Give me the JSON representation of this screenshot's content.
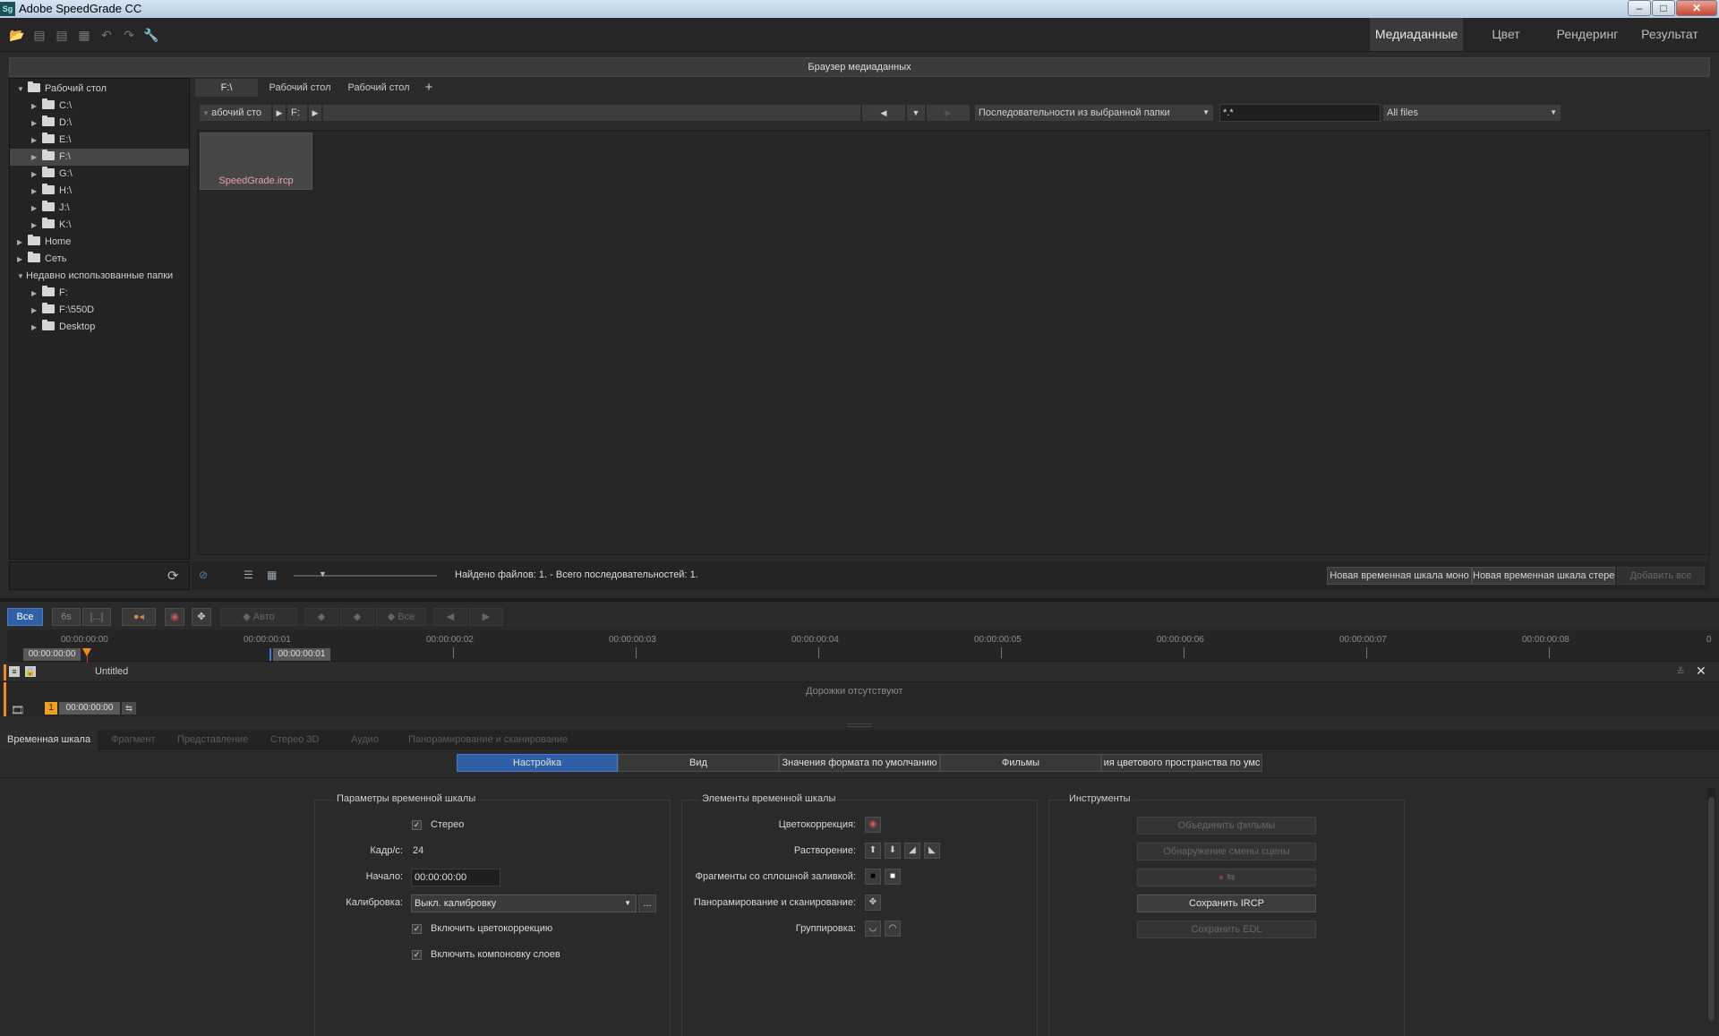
{
  "window": {
    "title": "Adobe SpeedGrade CC",
    "app_badge": "Sg",
    "minimize": "–",
    "maximize": "□",
    "close": "✕"
  },
  "toolbar": {
    "icons": [
      "open-folder-icon",
      "import-icon",
      "export-icon",
      "save-icon",
      "undo-icon",
      "redo-icon",
      "wrench-icon"
    ],
    "workspace_tabs": [
      "Медиаданные",
      "Цвет",
      "Рендеринг",
      "Результат"
    ],
    "active_workspace": "Медиаданные"
  },
  "media_browser": {
    "header": "Браузер медиаданных",
    "tree": [
      {
        "label": "Рабочий стол",
        "level": 0,
        "expanded": true
      },
      {
        "label": "C:\\",
        "level": 1,
        "expanded": false
      },
      {
        "label": "D:\\",
        "level": 1,
        "expanded": false
      },
      {
        "label": "E:\\",
        "level": 1,
        "expanded": false
      },
      {
        "label": "F:\\",
        "level": 1,
        "expanded": false,
        "selected": true
      },
      {
        "label": "G:\\",
        "level": 1,
        "expanded": false
      },
      {
        "label": "H:\\",
        "level": 1,
        "expanded": false
      },
      {
        "label": "J:\\",
        "level": 1,
        "expanded": false
      },
      {
        "label": "K:\\",
        "level": 1,
        "expanded": false
      },
      {
        "label": "Home",
        "level": 0,
        "expanded": false
      },
      {
        "label": "Сеть",
        "level": 0,
        "expanded": false
      },
      {
        "label": "Недавно использованные папки",
        "level": 0,
        "expanded": true,
        "no_folder": true
      },
      {
        "label": "F:",
        "level": 1,
        "expanded": false
      },
      {
        "label": "F:\\550D",
        "level": 1,
        "expanded": false
      },
      {
        "label": "Desktop",
        "level": 1,
        "expanded": false
      }
    ],
    "tabs": [
      "F:\\",
      "Рабочий стол",
      "Рабочий стол"
    ],
    "add_tab": "+",
    "path": {
      "segment1": "абочий сто",
      "segment2": "F:",
      "arrow": "▶",
      "prev": "◀",
      "down": "▼",
      "next": "▶"
    },
    "sequence_mode": "Последовательности из выбранной папки",
    "filter": "*.*",
    "file_type": "All files",
    "files": [
      {
        "name": "SpeedGrade.ircp"
      }
    ],
    "status": "Найдено файлов: 1. - Всего последовательностей: 1.",
    "buttons": {
      "new_mono": "Новая временная шкала моно",
      "new_stereo": "Новая временная шкала стерео",
      "add_all": "Добавить все"
    }
  },
  "timeline_toolbar": {
    "all": "Все",
    "six_s": "6s",
    "bracket": "|...|",
    "auto": "◆ Авто",
    "all2": "◆ Все"
  },
  "timeline": {
    "ruler_labels": [
      "00:00:00:00",
      "00:00:00:01",
      "00:00:00:02",
      "00:00:00:03",
      "00:00:00:04",
      "00:00:00:05",
      "00:00:00:06",
      "00:00:00:07",
      "00:00:00:08",
      "0"
    ],
    "in_marker": "00:00:00:00",
    "out_marker": "00:00:00:01",
    "track_name": "Untitled",
    "no_tracks": "Дорожки отсутствуют",
    "clip_number": "1",
    "clip_time": "00:00:00:00"
  },
  "bottom_tabs": [
    "Временная шкала",
    "Фрагмент",
    "Представление",
    "Стерео 3D",
    "Аудио",
    "Панорамирование и сканирование"
  ],
  "settings_tabs": [
    "Настройка",
    "Вид",
    "Значения формата по умолчанию",
    "Фильмы",
    "ия цветового пространства по умс"
  ],
  "params": {
    "title": "Параметры временной шкалы",
    "stereo": "Стерео",
    "fps_label": "Кадр/с:",
    "fps_value": "24",
    "start_label": "Начало:",
    "start_value": "00:00:00:00",
    "calibration_label": "Калибровка:",
    "calibration_value": "Выкл. калибровку",
    "ellipsis": "...",
    "enable_cc": "Включить цветокоррекцию",
    "enable_layers": "Включить компоновку слоев"
  },
  "elements": {
    "title": "Элементы временной шкалы",
    "cc": "Цветокоррекция:",
    "dissolve": "Растворение:",
    "solid": "Фрагменты со сплошной заливкой:",
    "pan": "Панорамирование и сканирование:",
    "group": "Группировка:"
  },
  "tools": {
    "title": "Инструменты",
    "merge": "Объединить фильмы",
    "scene": "Обнаружение смены сцены",
    "save_ircp": "Сохранить IRCP",
    "save_edl": "Сохранить EDL"
  }
}
